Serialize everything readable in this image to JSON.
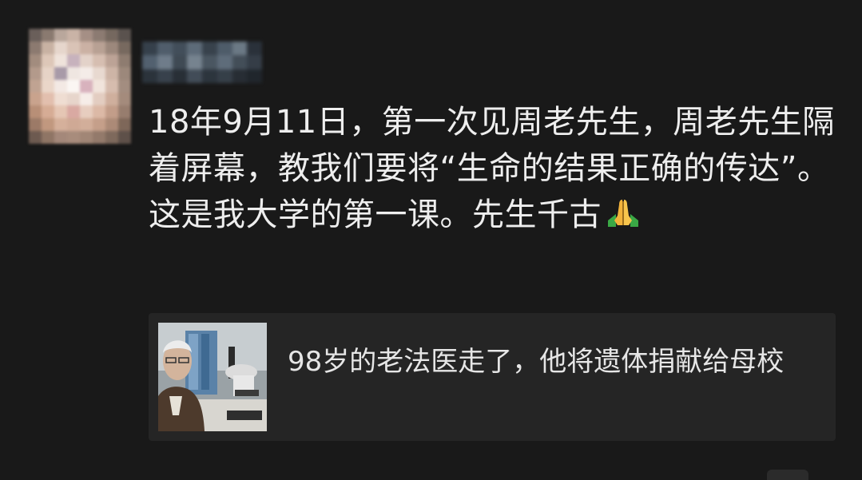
{
  "post": {
    "text": "18年9月11日，第一次见周老先生，周老先生隔着屏幕，教我们要将“生命的结果正确的传达”。这是我大学的第一课。先生千古",
    "emoji": "folded-hands-icon"
  },
  "link_card": {
    "title": "98岁的老法医走了，他将遗体捐献给母校",
    "thumbnail": "elderly-man-with-microscope-photo"
  },
  "colors": {
    "background": "#191919",
    "card_background": "#252525",
    "text": "#eeeeee"
  }
}
